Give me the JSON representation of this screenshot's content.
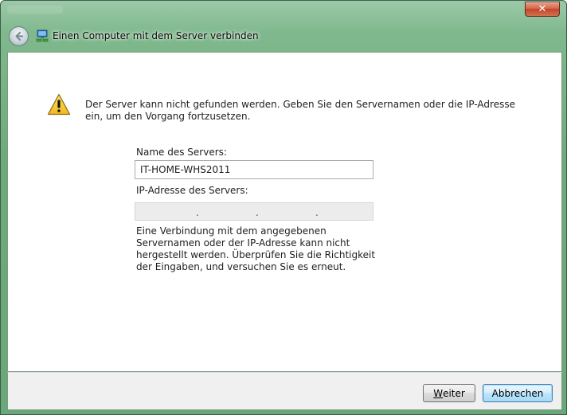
{
  "window": {
    "title": "Einen Computer mit dem Server verbinden",
    "close_glyph": "✕"
  },
  "icons": {
    "back": "back-arrow-icon",
    "nav": "network-computer-icon",
    "warning": "warning-triangle-icon"
  },
  "message": {
    "warning_text": "Der Server kann nicht gefunden werden. Geben Sie den Servernamen oder die IP-Adresse ein, um den Vorgang fortzusetzen."
  },
  "form": {
    "server_name_label": "Name des Servers:",
    "server_name_value": "IT-HOME-WHS2011",
    "ip_label": "IP-Adresse des Servers:",
    "ip_separators": [
      ".",
      ".",
      "."
    ]
  },
  "error": {
    "text": "Eine Verbindung mit dem angegebenen Servernamen oder der IP-Adresse kann nicht hergestellt werden. Überprüfen Sie die Richtigkeit der Eingaben, und versuchen Sie es erneut."
  },
  "buttons": {
    "next_first": "W",
    "next_rest": "eiter",
    "cancel": "Abbrechen"
  },
  "colors": {
    "aero_frame": "#6daa7b",
    "close_red": "#c24528",
    "default_button_border": "#3c7fb1"
  }
}
